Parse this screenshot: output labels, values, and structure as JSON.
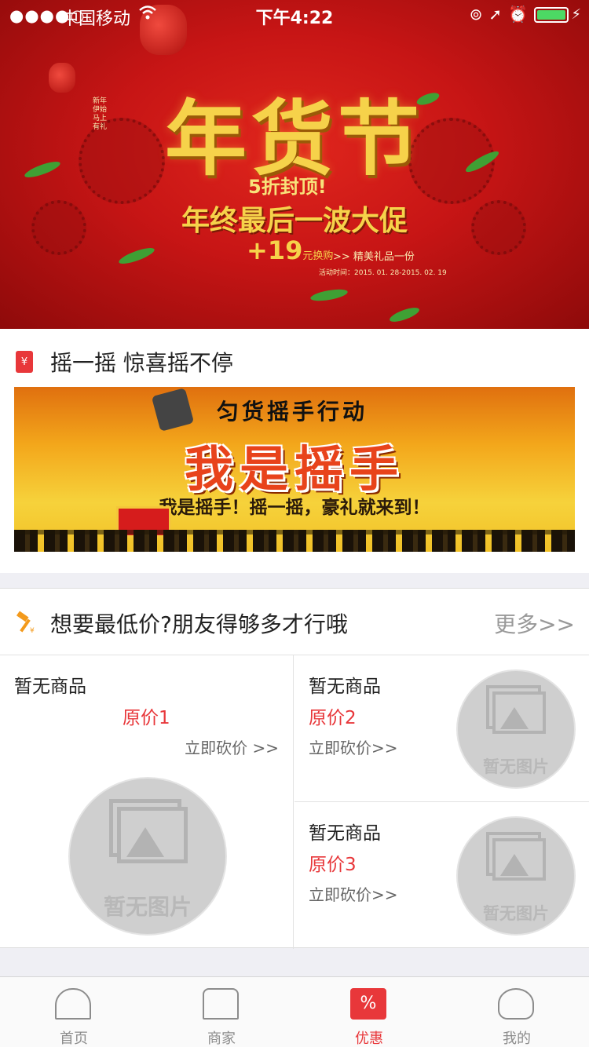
{
  "status_bar": {
    "signal": "●●●●○",
    "carrier": "中国移动",
    "time": "下午4:22"
  },
  "hero": {
    "title": "年货节",
    "cap_line": "5折封顶!",
    "subtitle": "年终最后一波大促",
    "plus": "+19",
    "plus_unit": "元换购",
    "gift": ">> 精美礼品一份",
    "date": "活动时间：2015. 01. 28-2015. 02. 19",
    "side_text": "新年伊始 马上有礼"
  },
  "shake": {
    "title": "摇一摇 惊喜摇不停",
    "banner_top": "匀货摇手行动",
    "banner_main": "我是摇手",
    "banner_line": "我是摇手！摇一摇，豪礼就来到！"
  },
  "bargain": {
    "title": "想要最低价?朋友得够多才行哦",
    "more": "更多>>",
    "items": [
      {
        "name": "暂无商品",
        "price": "原价1",
        "cut": "立即砍价 >>",
        "no_image": "暂无图片"
      },
      {
        "name": "暂无商品",
        "price": "原价2",
        "cut": "立即砍价>>",
        "no_image": "暂无图片"
      },
      {
        "name": "暂无商品",
        "price": "原价3",
        "cut": "立即砍价>>",
        "no_image": "暂无图片"
      }
    ]
  },
  "tabs": [
    {
      "label": "首页",
      "icon": "home-icon",
      "active": false
    },
    {
      "label": "商家",
      "icon": "shop-icon",
      "active": false
    },
    {
      "label": "优惠",
      "icon": "discount-icon",
      "active": true
    },
    {
      "label": "我的",
      "icon": "user-icon",
      "active": false
    }
  ],
  "colors": {
    "accent": "#e8373a",
    "banner_red": "#c71515",
    "gold": "#f6d24a"
  }
}
